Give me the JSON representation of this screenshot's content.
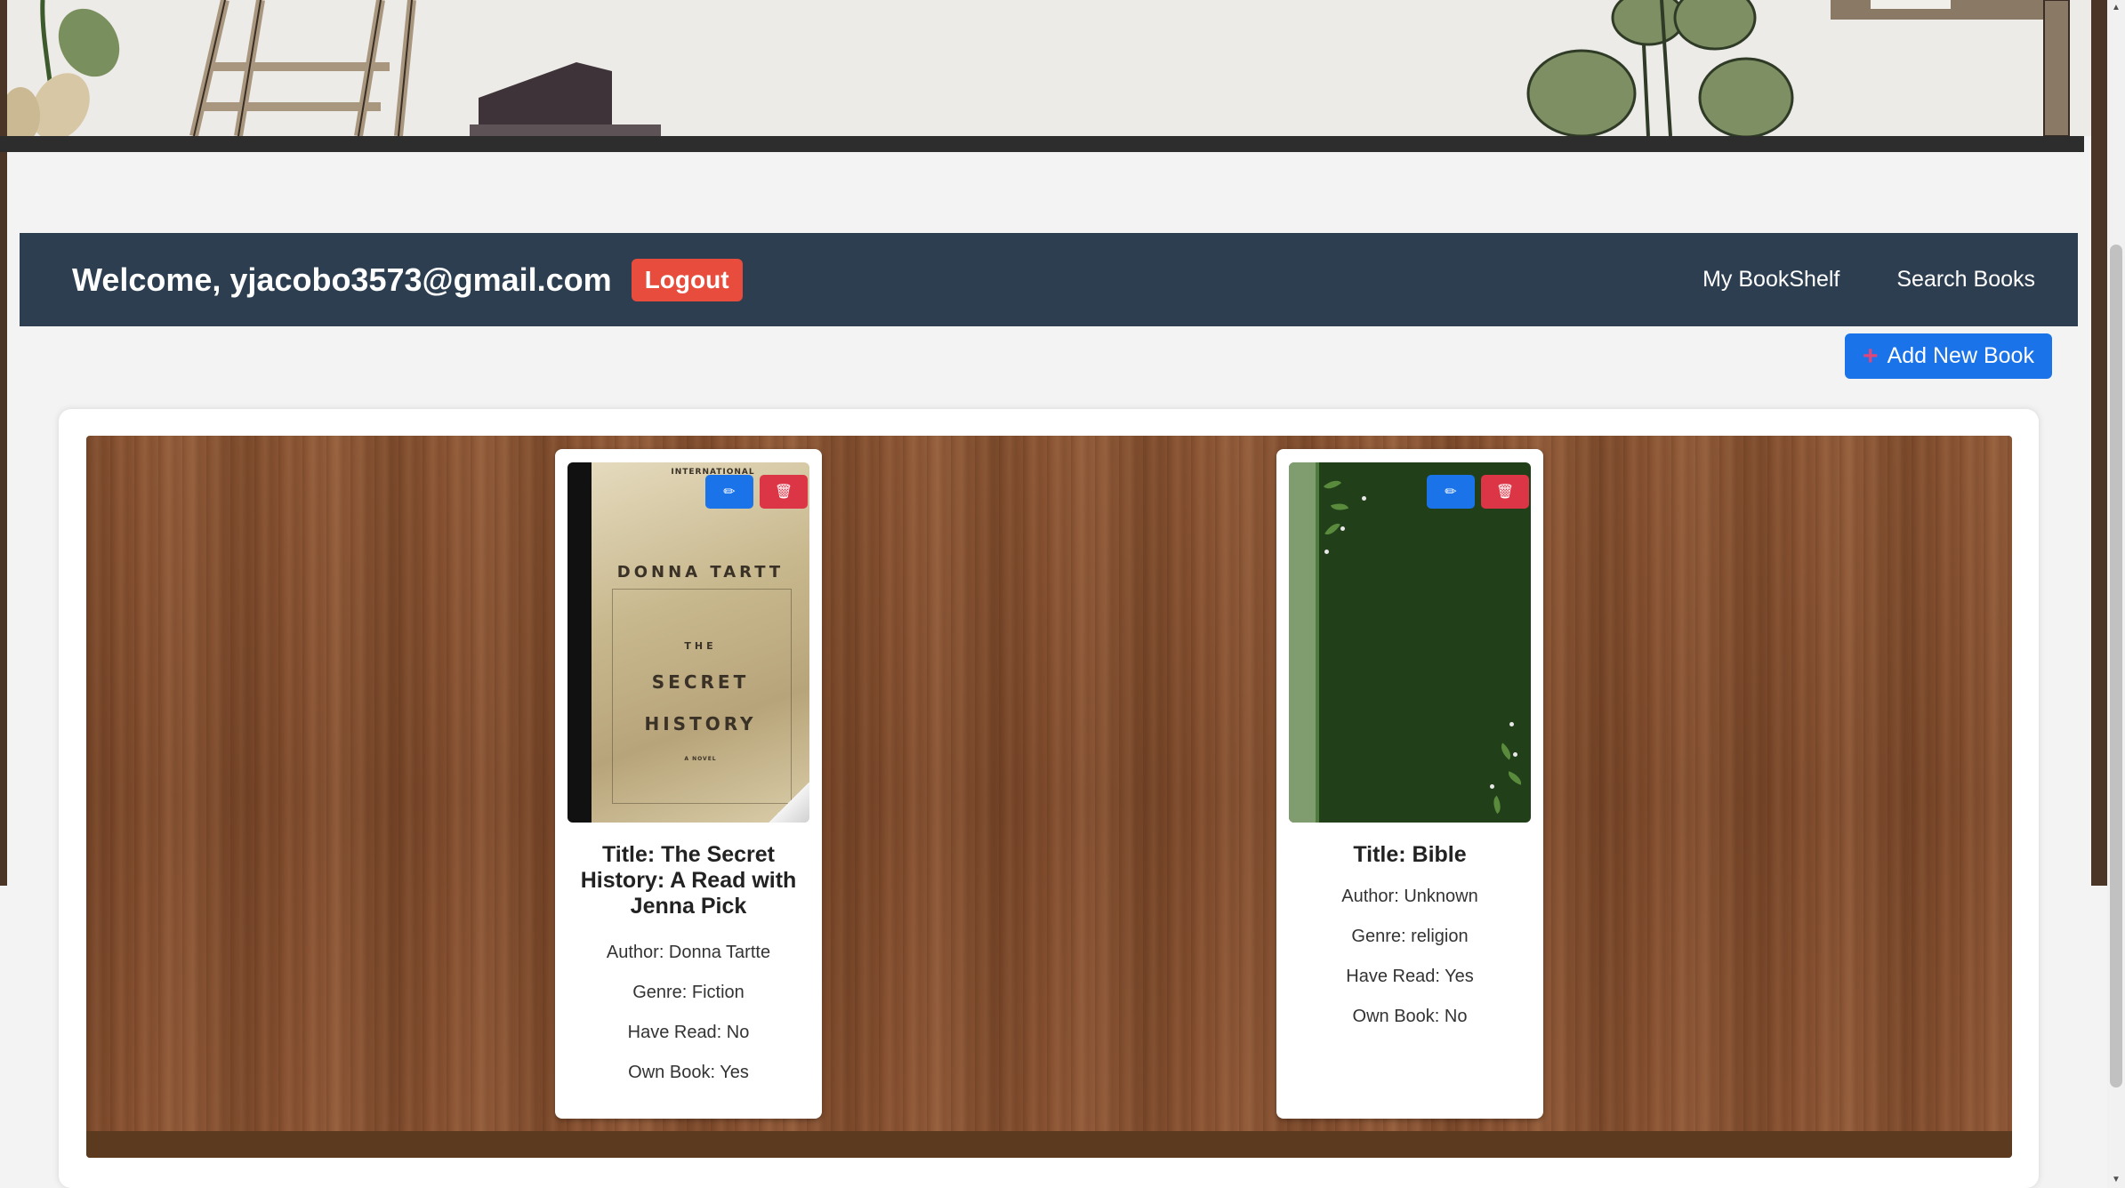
{
  "navbar": {
    "welcome_text": "Welcome, yjacobo3573@gmail.com",
    "logout_label": "Logout",
    "links": [
      "My BookShelf",
      "Search Books"
    ]
  },
  "actions": {
    "add_book_label": "Add New Book",
    "add_icon": "plus-icon"
  },
  "books": [
    {
      "title": "Title: The Secret History: A Read with Jenna Pick",
      "author": "Author: Donna Tartte",
      "genre": "Genre: Fiction",
      "have_read": "Have Read: No",
      "own_book": "Own Book: Yes",
      "cover_text": {
        "top": "INTERNATIONAL",
        "author": "DONNA TARTT",
        "the": "THE",
        "secret": "SECRET",
        "history": "HISTORY",
        "novel": "A NOVEL"
      }
    },
    {
      "title": "Title: Bible",
      "author": "Author: Unknown",
      "genre": "Genre: religion",
      "have_read": "Have Read: Yes",
      "own_book": "Own Book: No"
    }
  ],
  "colors": {
    "navbar": "#2c3e50",
    "logout": "#e74c3c",
    "primary": "#1a73e8",
    "danger": "#dc3545",
    "wood": "#7e4a2c"
  }
}
